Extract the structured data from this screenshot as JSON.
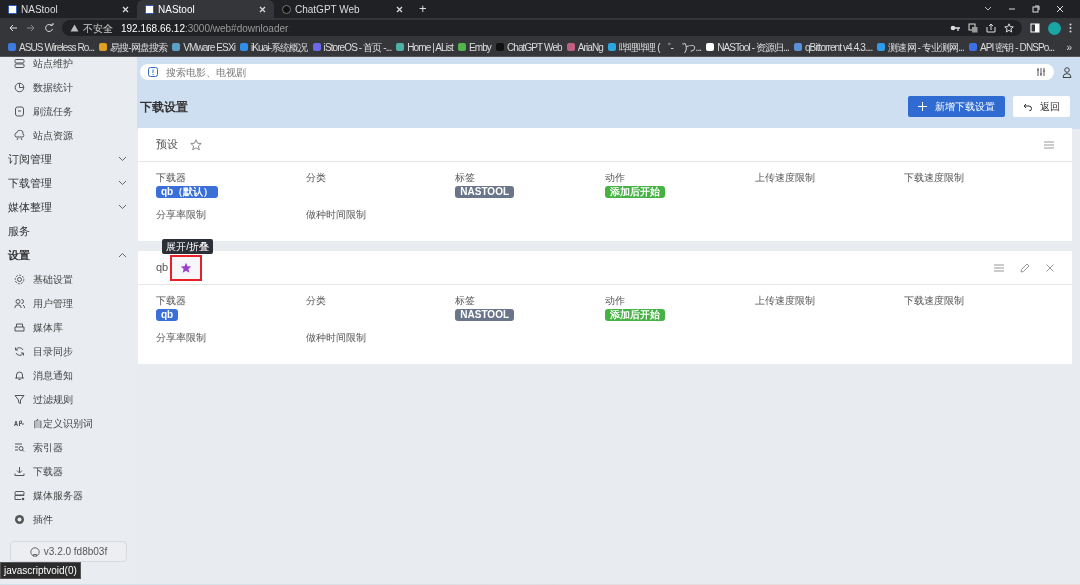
{
  "browser": {
    "tabs": [
      {
        "title": "NAStool",
        "selected": false
      },
      {
        "title": "NAStool",
        "selected": true
      },
      {
        "title": "ChatGPT Web",
        "selected": false
      }
    ],
    "new_tab": "+",
    "security": "不安全",
    "url_host": "192.168.66.12",
    "url_path": ":3000/web#downloader",
    "bookmarks": [
      {
        "title": "ASUS Wireless Ro...",
        "color": "#3d7be0"
      },
      {
        "title": "易搜-网盘搜索",
        "color": "#e0a020"
      },
      {
        "title": "VMware ESXi",
        "color": "#5aa0c8"
      },
      {
        "title": "iKuai-系统概况",
        "color": "#2f8fe8"
      },
      {
        "title": "iStoreOS - 首页 -...",
        "color": "#6a6ae8"
      },
      {
        "title": "Home | AList",
        "color": "#4fb0a8"
      },
      {
        "title": "Emby",
        "color": "#52b54b"
      },
      {
        "title": "ChatGPT Web",
        "color": "#111111"
      },
      {
        "title": "AriaNg",
        "color": "#c06080"
      },
      {
        "title": "哔哩哔哩 ( ゜- ゜)つ...",
        "color": "#2aa6e0"
      },
      {
        "title": "NASTool - 资源归...",
        "color": "#ffffff"
      },
      {
        "title": "qBittorrent v4.4.3....",
        "color": "#5b8fd8"
      },
      {
        "title": "测速网 - 专业测网...",
        "color": "#2d9ce8"
      },
      {
        "title": "API 密钥 - DNSPo...",
        "color": "#3b6fe8"
      }
    ],
    "bookmarks_more": "»",
    "status_link": "javascriptvoid(0)"
  },
  "sidebar": {
    "items": [
      {
        "label": "站点维护",
        "kind": "link"
      },
      {
        "label": "数据统计",
        "kind": "link"
      },
      {
        "label": "刷流任务",
        "kind": "link"
      },
      {
        "label": "站点资源",
        "kind": "link"
      },
      {
        "label": "订阅管理",
        "kind": "group",
        "expanded": false
      },
      {
        "label": "下载管理",
        "kind": "group",
        "expanded": false
      },
      {
        "label": "媒体整理",
        "kind": "group",
        "expanded": false
      },
      {
        "label": "服务",
        "kind": "header"
      },
      {
        "label": "设置",
        "kind": "group",
        "expanded": true,
        "children": [
          {
            "label": "基础设置",
            "kind": "link"
          },
          {
            "label": "用户管理",
            "kind": "link"
          },
          {
            "label": "媒体库",
            "kind": "link"
          },
          {
            "label": "目录同步",
            "kind": "link"
          },
          {
            "label": "消息通知",
            "kind": "link"
          },
          {
            "label": "过滤规则",
            "kind": "link"
          },
          {
            "label": "自定义识别词",
            "kind": "link"
          },
          {
            "label": "索引器",
            "kind": "link"
          },
          {
            "label": "下载器",
            "kind": "link"
          },
          {
            "label": "媒体服务器",
            "kind": "link"
          },
          {
            "label": "插件",
            "kind": "link"
          }
        ]
      }
    ],
    "version": "v3.2.0 fd8b03f"
  },
  "search": {
    "placeholder": "搜索电影、电视剧"
  },
  "page": {
    "title": "下载设置",
    "buttons": [
      {
        "label": "新增下载设置",
        "kind": "primary"
      },
      {
        "label": "返回",
        "kind": "back"
      }
    ]
  },
  "cards": [
    {
      "title": "预设",
      "starred": false,
      "highlighted": false,
      "editable": false,
      "removable": false,
      "fields": [
        {
          "label": "下载器",
          "tags": [
            {
              "text": "qb（默认）",
              "color": "#3a6fd8"
            }
          ]
        },
        {
          "label": "分类"
        },
        {
          "label": "标签",
          "tags": [
            {
              "text": "NASTOOL",
              "color": "#6b7589"
            }
          ]
        },
        {
          "label": "动作",
          "tags": [
            {
              "text": "添加后开始",
              "color": "#45b243"
            }
          ]
        },
        {
          "label": "上传速度限制"
        },
        {
          "label": "下载速度限制"
        },
        {
          "label": "分享率限制"
        },
        {
          "label": "做种时间限制"
        }
      ]
    },
    {
      "title": "qb",
      "starred": true,
      "highlighted": true,
      "tooltip": "展开/折叠",
      "editable": true,
      "removable": true,
      "fields": [
        {
          "label": "下载器",
          "tags": [
            {
              "text": "qb",
              "color": "#3a6fd8"
            }
          ]
        },
        {
          "label": "分类"
        },
        {
          "label": "标签",
          "tags": [
            {
              "text": "NASTOOL",
              "color": "#6b7589"
            }
          ]
        },
        {
          "label": "动作",
          "tags": [
            {
              "text": "添加后开始",
              "color": "#45b243"
            }
          ]
        },
        {
          "label": "上传速度限制"
        },
        {
          "label": "下载速度限制"
        },
        {
          "label": "分享率限制"
        },
        {
          "label": "做种时间限制"
        }
      ]
    }
  ]
}
